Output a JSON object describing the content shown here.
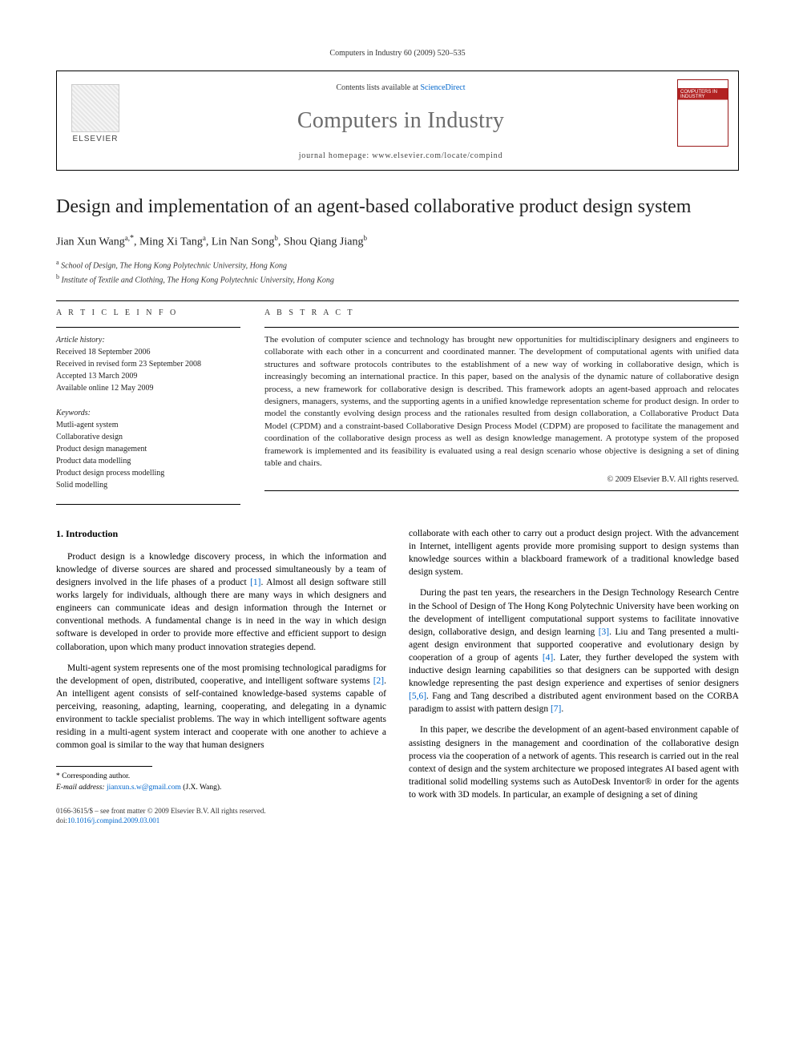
{
  "running_head": "Computers in Industry 60 (2009) 520–535",
  "header": {
    "contents_prefix": "Contents lists available at ",
    "sciencedirect": "ScienceDirect",
    "journal": "Computers in Industry",
    "homepage_label": "journal homepage: www.elsevier.com/locate/compind",
    "publisher": "ELSEVIER",
    "cover_text": "COMPUTERS IN INDUSTRY"
  },
  "title": "Design and implementation of an agent-based collaborative product design system",
  "authors_line": {
    "a1_name": "Jian Xun Wang",
    "a1_aff": "a,",
    "a1_corr": "*",
    "a2_name": "Ming Xi Tang",
    "a2_aff": "a",
    "a3_name": "Lin Nan Song",
    "a3_aff": "b",
    "a4_name": "Shou Qiang Jiang",
    "a4_aff": "b"
  },
  "affiliations": {
    "a": "School of Design, The Hong Kong Polytechnic University, Hong Kong",
    "b": "Institute of Textile and Clothing, The Hong Kong Polytechnic University, Hong Kong"
  },
  "info": {
    "label": "A R T I C L E   I N F O",
    "history_label": "Article history:",
    "received": "Received 18 September 2006",
    "revised": "Received in revised form 23 September 2008",
    "accepted": "Accepted 13 March 2009",
    "online": "Available online 12 May 2009",
    "keywords_label": "Keywords:",
    "keywords": [
      "Mutli-agent system",
      "Collaborative design",
      "Product design management",
      "Product data modelling",
      "Product design process modelling",
      "Solid modelling"
    ]
  },
  "abstract": {
    "label": "A B S T R A C T",
    "text": "The evolution of computer science and technology has brought new opportunities for multidisciplinary designers and engineers to collaborate with each other in a concurrent and coordinated manner. The development of computational agents with unified data structures and software protocols contributes to the establishment of a new way of working in collaborative design, which is increasingly becoming an international practice. In this paper, based on the analysis of the dynamic nature of collaborative design process, a new framework for collaborative design is described. This framework adopts an agent-based approach and relocates designers, managers, systems, and the supporting agents in a unified knowledge representation scheme for product design. In order to model the constantly evolving design process and the rationales resulted from design collaboration, a Collaborative Product Data Model (CPDM) and a constraint-based Collaborative Design Process Model (CDPM) are proposed to facilitate the management and coordination of the collaborative design process as well as design knowledge management. A prototype system of the proposed framework is implemented and its feasibility is evaluated using a real design scenario whose objective is designing a set of dining table and chairs.",
    "copyright": "© 2009 Elsevier B.V. All rights reserved."
  },
  "body": {
    "heading": "1. Introduction",
    "left": [
      "Product design is a knowledge discovery process, in which the information and knowledge of diverse sources are shared and processed simultaneously by a team of designers involved in the life phases of a product [1]. Almost all design software still works largely for individuals, although there are many ways in which designers and engineers can communicate ideas and design information through the Internet or conventional methods. A fundamental change is in need in the way in which design software is developed in order to provide more effective and efficient support to design collaboration, upon which many product innovation strategies depend.",
      "Multi-agent system represents one of the most promising technological paradigms for the development of open, distributed, cooperative, and intelligent software systems [2]. An intelligent agent consists of self-contained knowledge-based systems capable of perceiving, reasoning, adapting, learning, cooperating, and delegating in a dynamic environment to tackle specialist problems. The way in which intelligent software agents residing in a multi-agent system interact and cooperate with one another to achieve a common goal is similar to the way that human designers"
    ],
    "right": [
      "collaborate with each other to carry out a product design project. With the advancement in Internet, intelligent agents provide more promising support to design systems than knowledge sources within a blackboard framework of a traditional knowledge based design system.",
      "During the past ten years, the researchers in the Design Technology Research Centre in the School of Design of The Hong Kong Polytechnic University have been working on the development of intelligent computational support systems to facilitate innovative design, collaborative design, and design learning [3]. Liu and Tang presented a multi-agent design environment that supported cooperative and evolutionary design by cooperation of a group of agents [4]. Later, they further developed the system with inductive design learning capabilities so that designers can be supported with design knowledge representing the past design experience and expertises of senior designers [5,6]. Fang and Tang described a distributed agent environment based on the CORBA paradigm to assist with pattern design [7].",
      "In this paper, we describe the development of an agent-based environment capable of assisting designers in the management and coordination of the collaborative design process via the cooperation of a network of agents. This research is carried out in the real context of design and the system architecture we proposed integrates AI based agent with traditional solid modelling systems such as AutoDesk Inventor® in order for the agents to work with 3D models. In particular, an example of designing a set of dining"
    ]
  },
  "footnotes": {
    "corr": "* Corresponding author.",
    "email_label": "E-mail address:",
    "email": "jianxun.s.w@gmail.com",
    "email_tail": "(J.X. Wang)."
  },
  "bottom": {
    "line1": "0166-3615/$ – see front matter © 2009 Elsevier B.V. All rights reserved.",
    "doi_label": "doi:",
    "doi": "10.1016/j.compind.2009.03.001"
  }
}
